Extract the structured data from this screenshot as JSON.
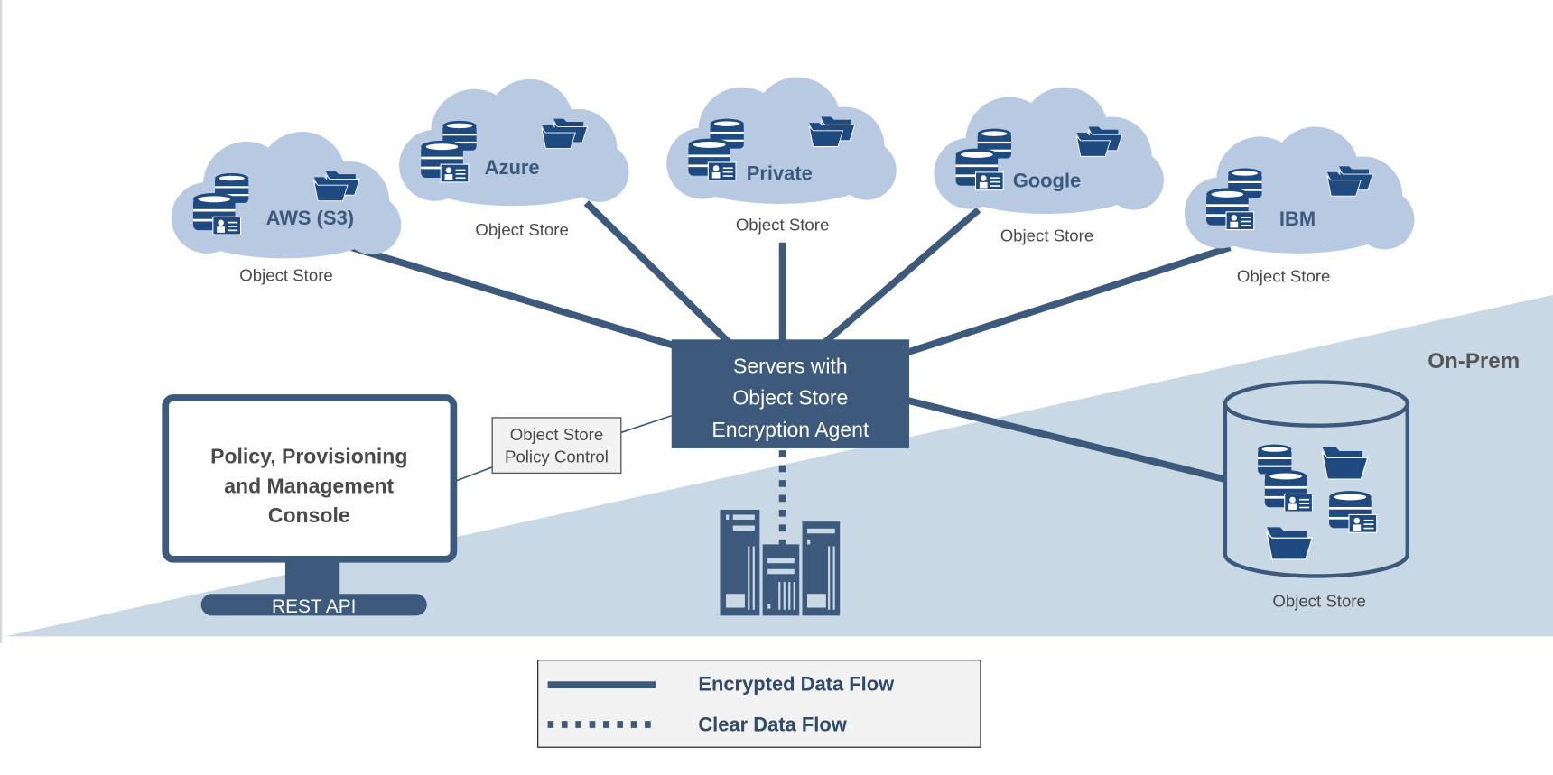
{
  "colors": {
    "primary": "#3d5a7d",
    "cloud": "#b8c9e2",
    "onprem_zone": "#c8d9e5",
    "icon": "#1f4a7f",
    "text": "#4a4a4a"
  },
  "clouds": [
    {
      "name": "AWS (S3)",
      "sublabel": "Object Store"
    },
    {
      "name": "Azure",
      "sublabel": "Object Store"
    },
    {
      "name": "Private",
      "sublabel": "Object Store"
    },
    {
      "name": "Google",
      "sublabel": "Object Store"
    },
    {
      "name": "IBM",
      "sublabel": "Object Store"
    }
  ],
  "agent": {
    "lines": [
      "Servers with",
      "Object Store",
      "Encryption Agent"
    ]
  },
  "policy_control": {
    "lines": [
      "Object Store",
      "Policy Control"
    ]
  },
  "console": {
    "lines": [
      "Policy, Provisioning",
      "and Management",
      "Console"
    ],
    "base_label": "REST API"
  },
  "onprem": {
    "title": "On-Prem",
    "store_label": "Object Store"
  },
  "legend": {
    "encrypted": "Encrypted Data Flow",
    "clear": "Clear Data Flow"
  }
}
